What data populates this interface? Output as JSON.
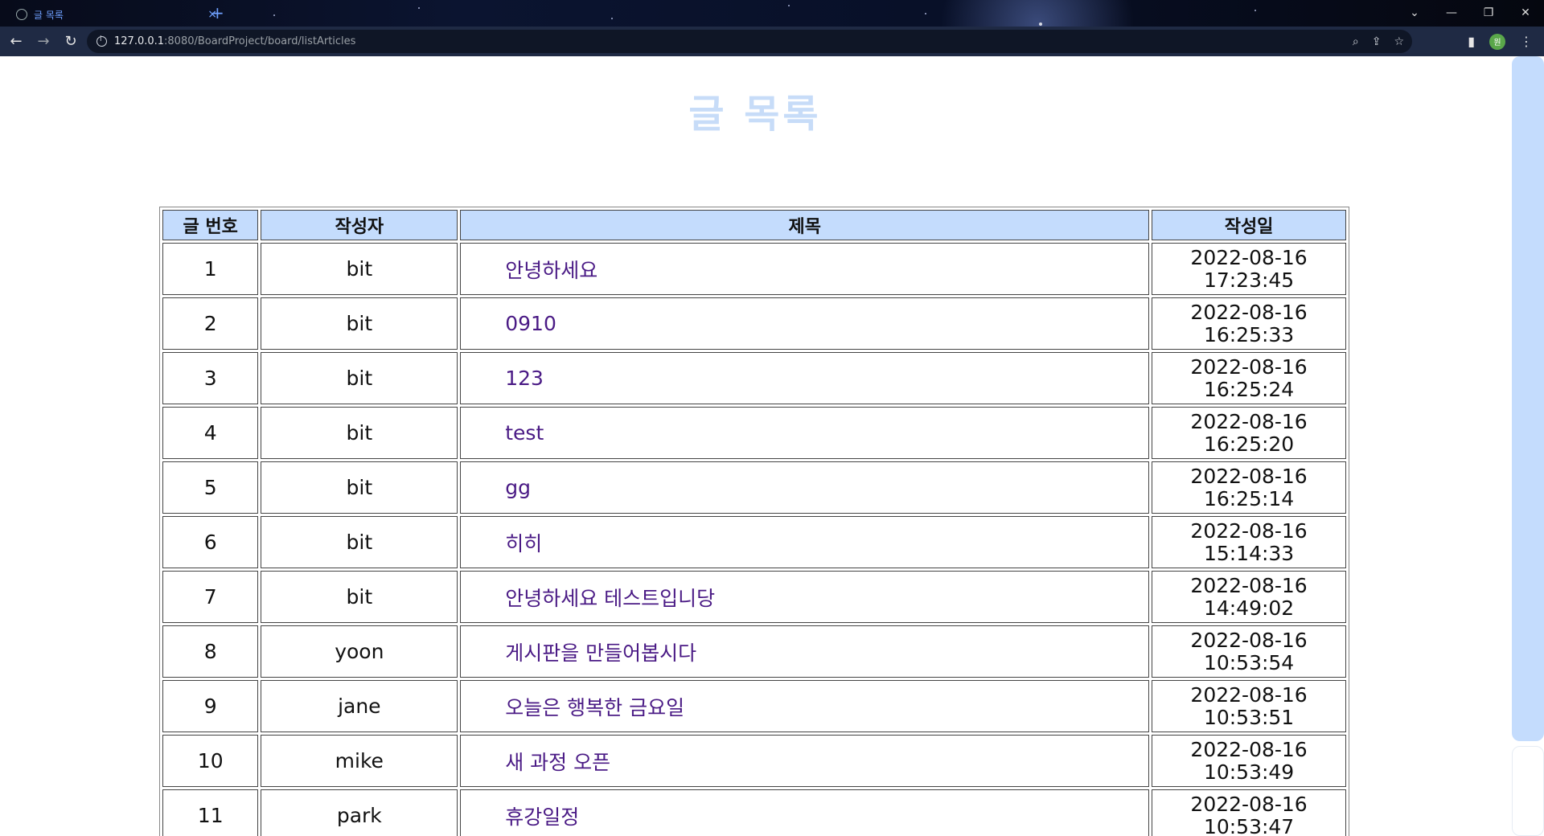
{
  "browser": {
    "tab_title": "글 목록",
    "tab_close": "×",
    "new_tab": "+",
    "url_host": "127.0.0.1",
    "url_path": ":8080/BoardProject/board/listArticles",
    "profile_initial": "원"
  },
  "page": {
    "title": "글 목록"
  },
  "table": {
    "headers": [
      "글 번호",
      "작성자",
      "제목",
      "작성일"
    ],
    "rows": [
      {
        "no": "1",
        "writer": "bit",
        "title": "안녕하세요",
        "date1": "2022-08-16",
        "date2": "17:23:45"
      },
      {
        "no": "2",
        "writer": "bit",
        "title": "0910",
        "date1": "2022-08-16",
        "date2": "16:25:33"
      },
      {
        "no": "3",
        "writer": "bit",
        "title": "123",
        "date1": "2022-08-16",
        "date2": "16:25:24"
      },
      {
        "no": "4",
        "writer": "bit",
        "title": "test",
        "date1": "2022-08-16",
        "date2": "16:25:20"
      },
      {
        "no": "5",
        "writer": "bit",
        "title": "gg",
        "date1": "2022-08-16",
        "date2": "16:25:14"
      },
      {
        "no": "6",
        "writer": "bit",
        "title": "히히",
        "date1": "2022-08-16",
        "date2": "15:14:33"
      },
      {
        "no": "7",
        "writer": "bit",
        "title": "안녕하세요 테스트입니당",
        "date1": "2022-08-16",
        "date2": "14:49:02"
      },
      {
        "no": "8",
        "writer": "yoon",
        "title": "게시판을 만들어봅시다",
        "date1": "2022-08-16",
        "date2": "10:53:54"
      },
      {
        "no": "9",
        "writer": "jane",
        "title": "오늘은 행복한 금요일",
        "date1": "2022-08-16",
        "date2": "10:53:51"
      },
      {
        "no": "10",
        "writer": "mike",
        "title": "새 과정 오픈",
        "date1": "2022-08-16",
        "date2": "10:53:49"
      },
      {
        "no": "11",
        "writer": "park",
        "title": "휴강일정",
        "date1": "2022-08-16",
        "date2": "10:53:47"
      }
    ]
  },
  "colors": {
    "title": "#c7dcf8",
    "header_bg": "#c4dcfd",
    "link": "#4a1a85",
    "scrollbar": "#c4dcfd"
  }
}
